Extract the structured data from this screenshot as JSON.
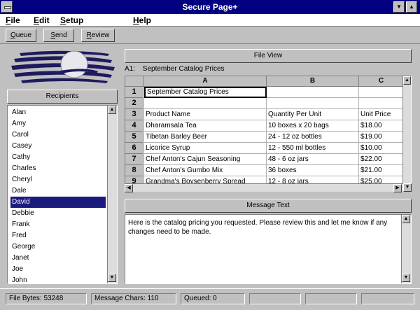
{
  "window": {
    "title": "Secure Page+"
  },
  "menu": {
    "file": "File",
    "edit": "Edit",
    "setup": "Setup",
    "help": "Help"
  },
  "toolbar": {
    "queue": "Queue",
    "send": "Send",
    "review": "Review"
  },
  "recipients": {
    "title": "Recipients",
    "selected_index": 9,
    "items": [
      "Alan",
      "Amy",
      "Carol",
      "Casey",
      "Cathy",
      "Charles",
      "Cheryl",
      "Dale",
      "David",
      "Debbie",
      "Frank",
      "Fred",
      "George",
      "Janet",
      "Joe",
      "John"
    ]
  },
  "file_view": {
    "title": "File View",
    "cell_ref": "A1:",
    "cell_ref_value": "September Catalog Prices",
    "columns": [
      "A",
      "B",
      "C"
    ],
    "rows": [
      {
        "num": "1",
        "a": "September Catalog Prices",
        "b": "",
        "c": ""
      },
      {
        "num": "2",
        "a": "",
        "b": "",
        "c": ""
      },
      {
        "num": "3",
        "a": "Product Name",
        "b": "Quantity Per Unit",
        "c": "Unit Price"
      },
      {
        "num": "4",
        "a": "Dharamsala Tea",
        "b": "10 boxes x 20 bags",
        "c": "$18.00"
      },
      {
        "num": "5",
        "a": "Tibetan Barley Beer",
        "b": "24 - 12 oz bottles",
        "c": "$19.00"
      },
      {
        "num": "6",
        "a": "Licorice Syrup",
        "b": "12 - 550 ml bottles",
        "c": "$10.00"
      },
      {
        "num": "7",
        "a": "Chef Anton's Cajun Seasoning",
        "b": "48 - 6 oz jars",
        "c": "$22.00"
      },
      {
        "num": "8",
        "a": "Chef Anton's Gumbo Mix",
        "b": "36 boxes",
        "c": "$21.00"
      },
      {
        "num": "9",
        "a": "Grandma's Boysenberry Spread",
        "b": "12 - 8 oz jars",
        "c": "$25.00"
      }
    ]
  },
  "message": {
    "title": "Message Text",
    "text": "Here is the catalog pricing you requested.  Please review this and let me know if any changes need to be made."
  },
  "status": {
    "file_bytes": "File Bytes: 53248",
    "message_chars": "Message Chars: 110",
    "queued": "Queued: 0"
  },
  "colors": {
    "title_bar": "#000080",
    "selection": "#1b1b7e",
    "face": "#c0c0c0"
  },
  "icons": {
    "system_menu": "system-menu-icon",
    "minimize": "minimize-icon",
    "maximize": "maximize-icon",
    "scroll_up": "scroll-up-icon",
    "scroll_down": "scroll-down-icon",
    "scroll_left": "scroll-left-icon",
    "scroll_right": "scroll-right-icon"
  }
}
